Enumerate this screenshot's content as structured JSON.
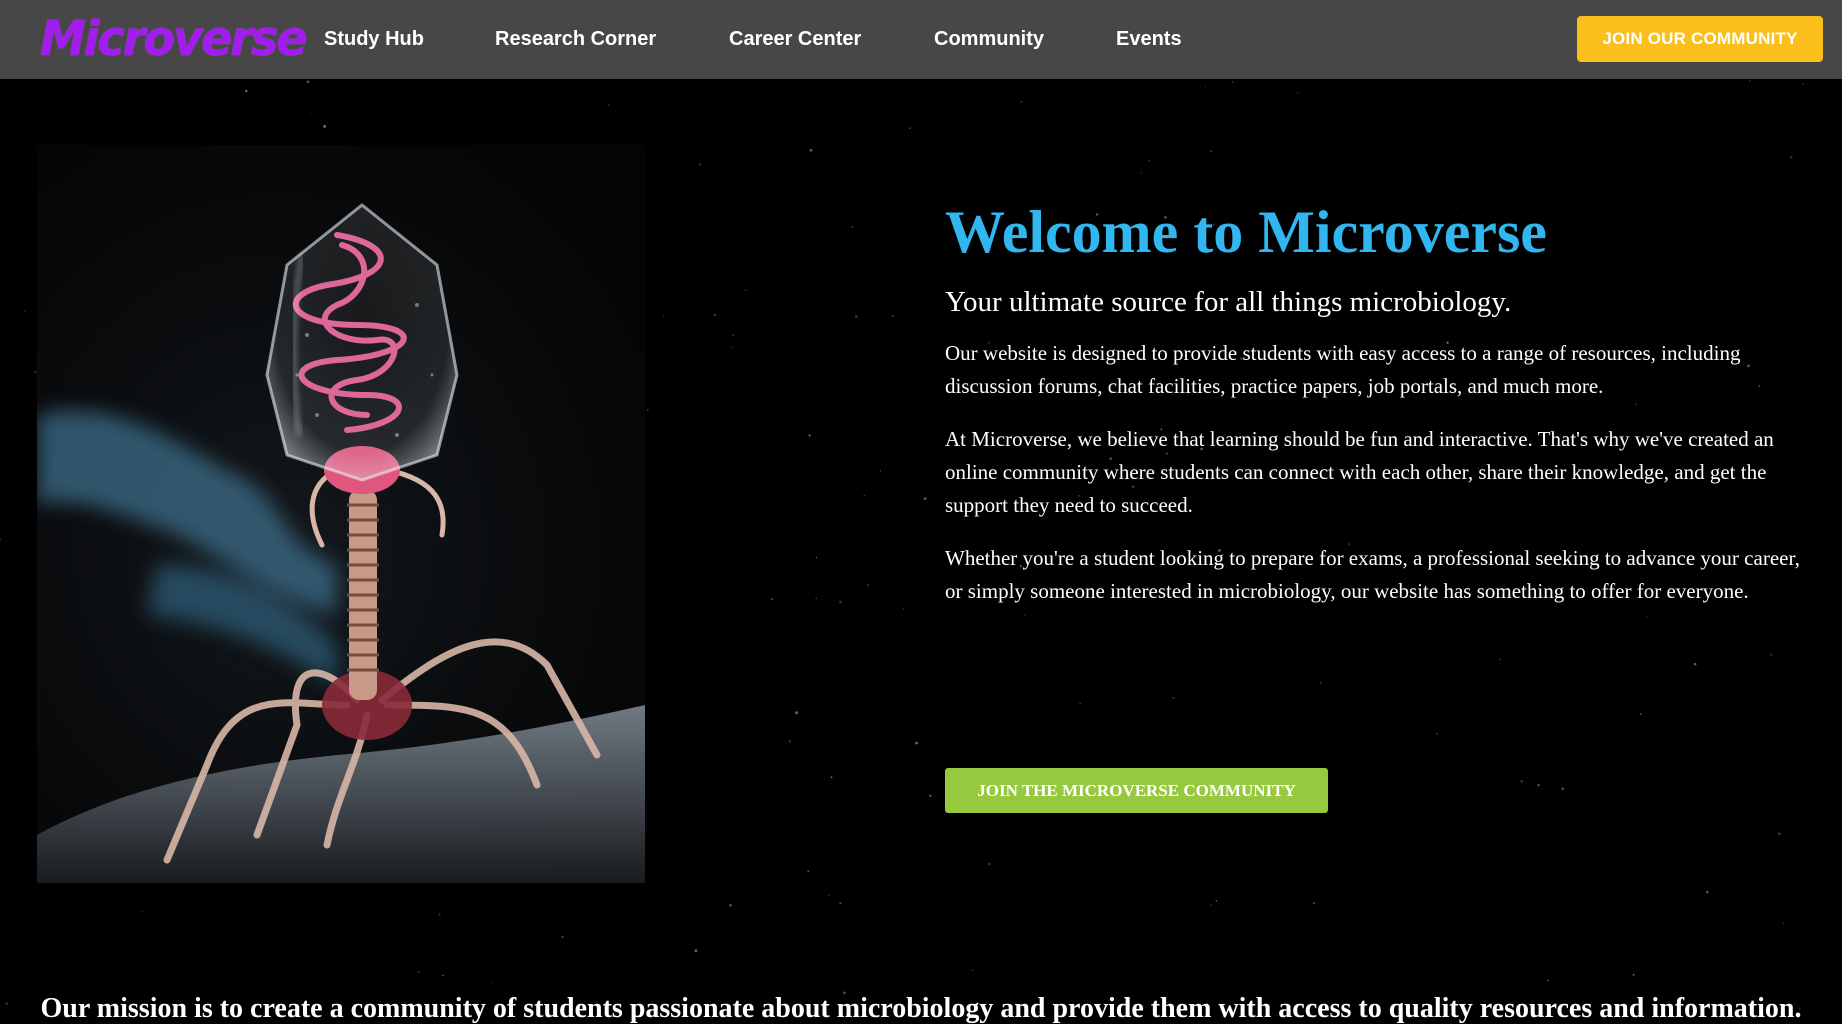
{
  "brand": {
    "name": "Microverse",
    "logo_color": "#a21cf0"
  },
  "nav": {
    "items": [
      {
        "label": "Study Hub"
      },
      {
        "label": "Research Corner"
      },
      {
        "label": "Career Center"
      },
      {
        "label": "Community"
      },
      {
        "label": "Events"
      }
    ],
    "cta_label": "JOIN OUR COMMUNITY",
    "cta_color": "#fbbf1b",
    "background": "#474747"
  },
  "hero": {
    "image_alt": "Illustration of a bacteriophage virus",
    "title": "Welcome to Microverse",
    "title_color": "#32b6ef",
    "subtitle": "Your ultimate source for all things microbiology.",
    "paragraphs": [
      "Our website is designed to provide students with easy access to a range of resources, including discussion forums, chat facilities, practice papers, job portals, and much more.",
      "At Microverse, we believe that learning should be fun and interactive. That's why we've created an online community where students can connect with each other, share their knowledge, and get the support they need to succeed.",
      "Whether you're a student looking to prepare for exams, a professional seeking to advance your career, or simply someone interested in microbiology, our website has something to offer for everyone."
    ],
    "cta_label": "JOIN THE MICROVERSE COMMUNITY",
    "cta_color": "#96c93d"
  },
  "mission": {
    "text": "Our mission is to create a community of students passionate about microbiology and provide them with access to quality resources and information."
  }
}
